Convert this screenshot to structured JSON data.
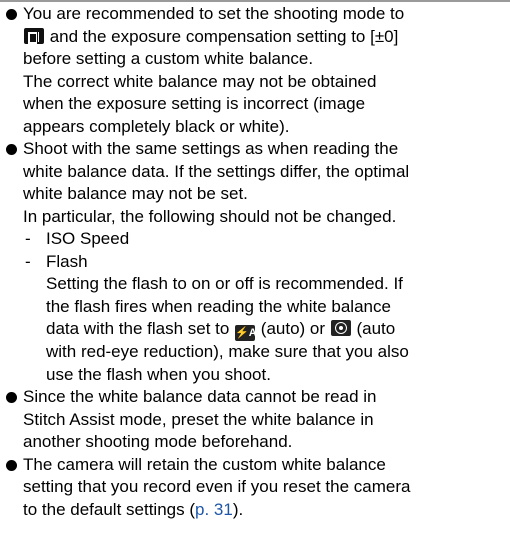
{
  "icons": {
    "shooting_mode": "manual-mode-icon",
    "flash_auto": "flash-auto-icon",
    "flash_redeye": "red-eye-reduction-icon"
  },
  "icon_text": {
    "flash_auto": "⚡A"
  },
  "colors": {
    "link": "#1f57a8"
  },
  "items": [
    {
      "l1": "You are recommended to set the shooting mode to",
      "l2_after_icon": " and the exposure compensation setting to [±0]",
      "l3": "before setting a custom white balance.",
      "l4": "The correct white balance may not be obtained",
      "l5": "when the exposure setting is incorrect (image",
      "l6": "appears completely black or white)."
    },
    {
      "l1": "Shoot with the same settings as when reading the",
      "l2": "white balance data. If the settings differ, the optimal",
      "l3": "white balance may not be set.",
      "l4": "In particular, the following should not be changed.",
      "sub1_dash": "-",
      "sub1": "ISO Speed",
      "sub2_dash": "-",
      "sub2": "Flash",
      "sub2_l1": "Setting the flash to on or off is recommended. If",
      "sub2_l2": "the flash fires when reading the white balance",
      "sub2_l3_before": "data with the flash set to ",
      "sub2_l3_mid": " (auto) or ",
      "sub2_l3_after": " (auto",
      "sub2_l4": "with red-eye reduction), make sure that you also",
      "sub2_l5": "use the flash when you shoot."
    },
    {
      "l1": "Since the white balance data cannot be read in",
      "l2": "Stitch Assist mode, preset the white balance in",
      "l3": "another shooting mode beforehand."
    },
    {
      "l1": "The camera will retain the custom white balance",
      "l2": "setting that you record even if you reset the camera",
      "l3_before": "to the default settings (",
      "l3_link": "p. 31",
      "l3_after": ")."
    }
  ]
}
